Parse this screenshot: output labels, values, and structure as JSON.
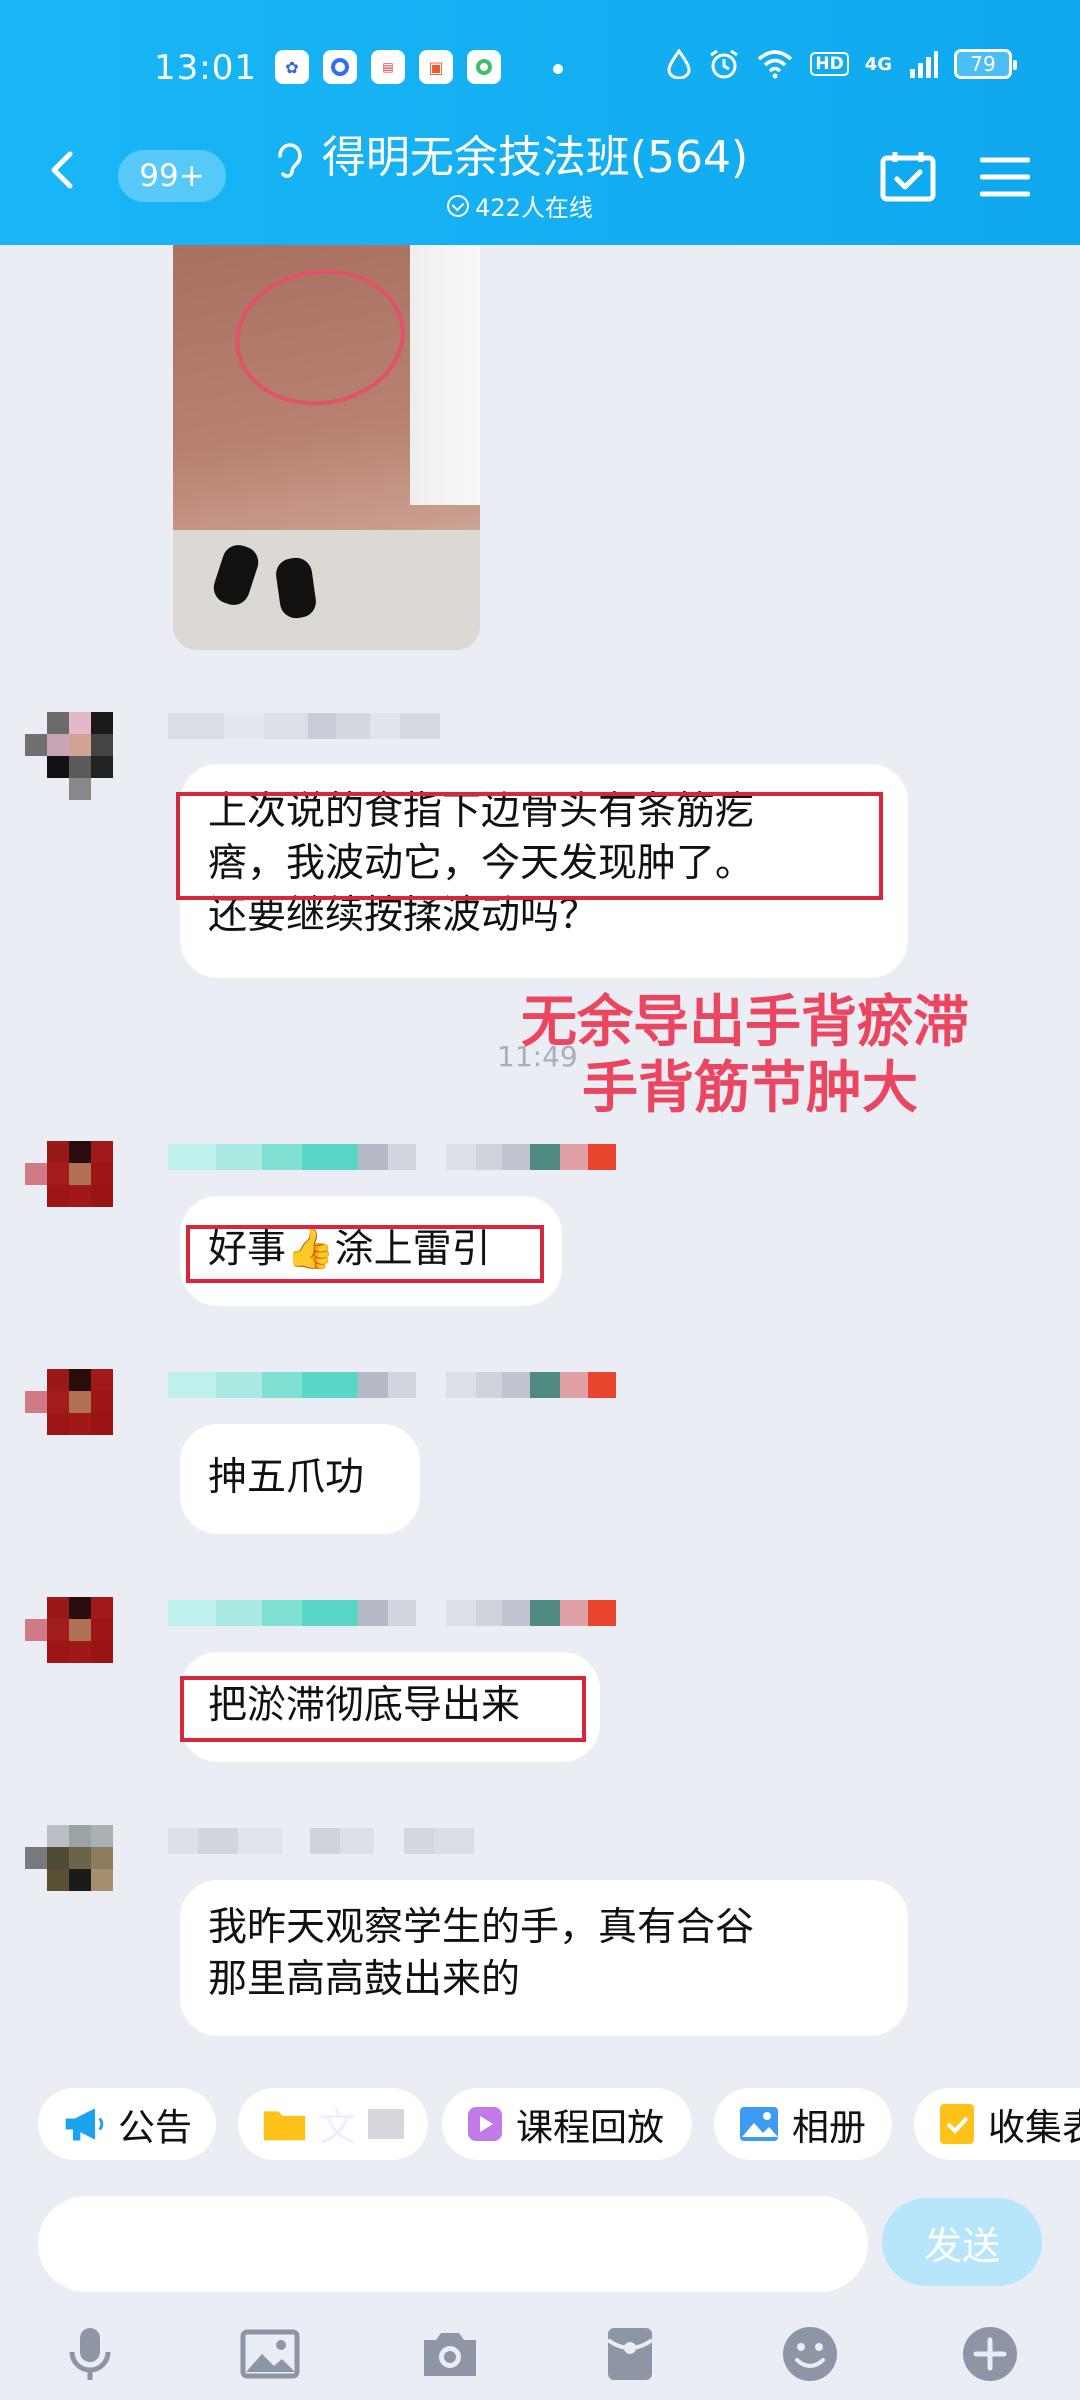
{
  "status_bar": {
    "time": "13:01",
    "battery": "79",
    "network": "4G",
    "hd": "HD"
  },
  "header": {
    "unread_badge": "99+",
    "title": "得明无余技法班(564)",
    "online": "422人在线"
  },
  "messages": [
    {
      "type": "image",
      "description": "hand-photo"
    },
    {
      "type": "text",
      "line1": "上次说的食指下边骨头有条筋疙",
      "line2": "瘩，我波动它，今天发现肿了。",
      "line3": "还要继续按揉波动吗？"
    },
    {
      "type": "text",
      "emoji": "👍",
      "before": "好事",
      "after": "涂上雷引"
    },
    {
      "type": "text",
      "text": "抻五爪功"
    },
    {
      "type": "text",
      "text": "把淤滞彻底导出来"
    },
    {
      "type": "text",
      "line1": "我昨天观察学生的手，真有合谷",
      "line2": "那里高高鼓出来的"
    }
  ],
  "timestamp": "11:49",
  "annotation": {
    "line1": "无余导出手背瘀滞",
    "line2": "手背筋节肿大"
  },
  "shortcuts": [
    {
      "label": "公告",
      "icon": "megaphone-icon"
    },
    {
      "label": "文",
      "icon": "folder-icon"
    },
    {
      "label": "课程回放",
      "icon": "replay-icon"
    },
    {
      "label": "相册",
      "icon": "album-icon"
    },
    {
      "label": "收集表",
      "icon": "form-icon"
    }
  ],
  "composer": {
    "send_label": "发送",
    "placeholder": ""
  },
  "toolbar": [
    "mic-icon",
    "image-icon",
    "camera-icon",
    "red-packet-icon",
    "emoji-icon",
    "plus-icon"
  ],
  "colors": {
    "header": "#12aef2",
    "annotation": "#ea4660",
    "highlight_box": "#d8263a",
    "background": "#eaedf4"
  }
}
